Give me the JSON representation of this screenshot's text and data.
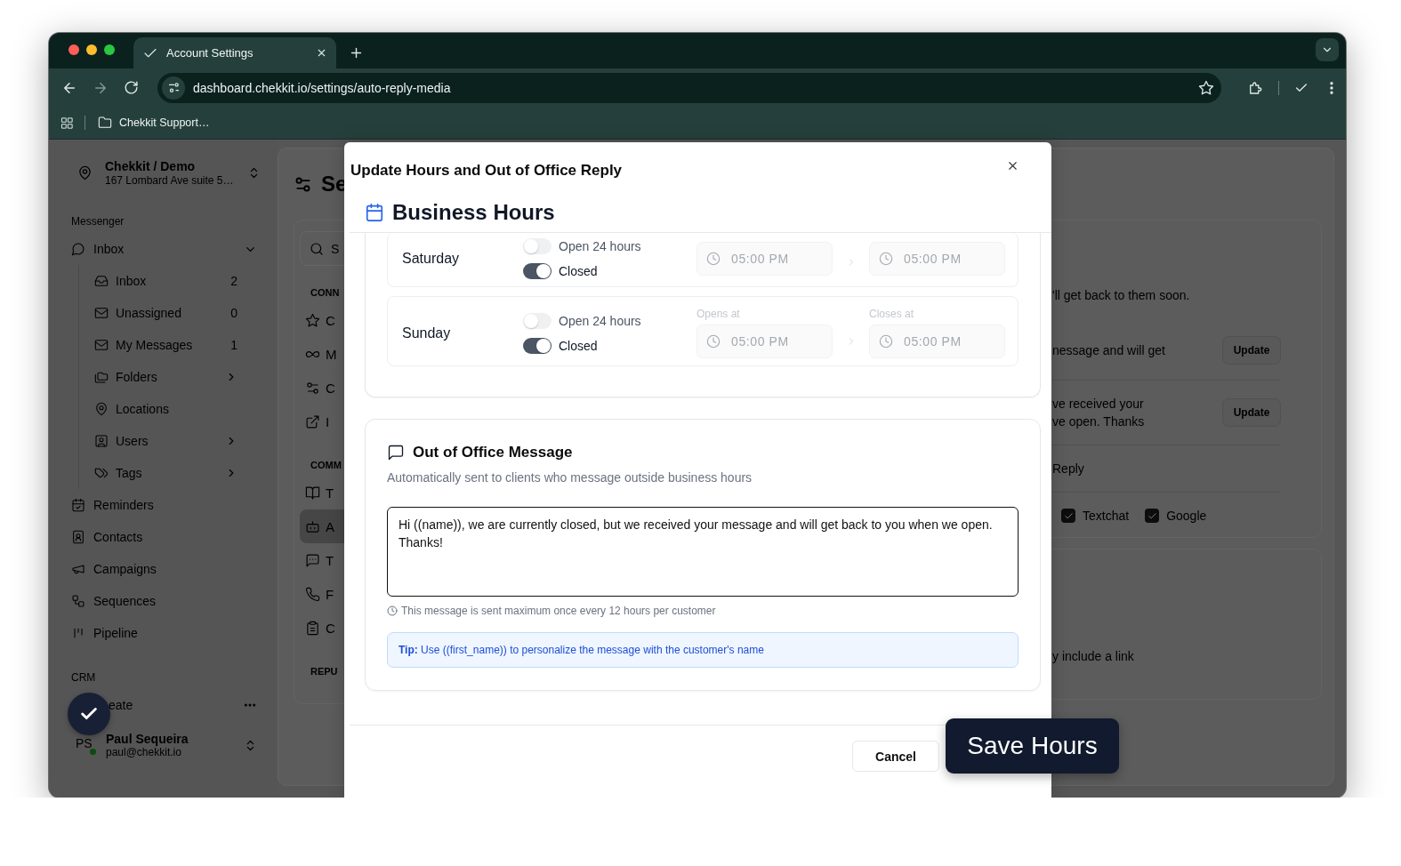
{
  "browser": {
    "tab": {
      "title": "Account Settings"
    },
    "url": "dashboard.chekkit.io/settings/auto-reply-media",
    "bookmarks": [
      {
        "label": "Chekkit Support…"
      }
    ]
  },
  "sidebar": {
    "location": {
      "name": "Chekkit / Demo",
      "address": "167 Lombard Ave suite 5…"
    },
    "messenger_label": "Messenger",
    "inbox": {
      "label": "Inbox",
      "expanded": true,
      "children": [
        {
          "label": "Inbox",
          "count": "2",
          "has_submenu": false
        },
        {
          "label": "Unassigned",
          "count": "0",
          "has_submenu": false
        },
        {
          "label": "My Messages",
          "count": "1",
          "has_submenu": false
        },
        {
          "label": "Folders",
          "has_submenu": true
        },
        {
          "label": "Locations",
          "has_submenu": false
        },
        {
          "label": "Users",
          "has_submenu": true
        },
        {
          "label": "Tags",
          "has_submenu": true
        }
      ]
    },
    "items": [
      {
        "label": "Reminders"
      },
      {
        "label": "Contacts"
      },
      {
        "label": "Campaigns"
      },
      {
        "label": "Sequences"
      },
      {
        "label": "Pipeline"
      }
    ],
    "crm_label": "CRM",
    "crm_items": [
      {
        "label": "eate"
      }
    ],
    "user": {
      "initials": "PS",
      "name": "Paul Sequeira",
      "email": "paul@chekkit.io",
      "online": true
    }
  },
  "settings": {
    "title": "Se",
    "search": {
      "placeholder": "S"
    },
    "groups": [
      {
        "label": "CONN",
        "items": [
          {
            "label": "C",
            "selected": false
          },
          {
            "label": "M",
            "selected": false
          },
          {
            "label": "C",
            "selected": false
          },
          {
            "label": "I",
            "selected": false
          }
        ]
      },
      {
        "label": "COMM",
        "items": [
          {
            "label": "T",
            "selected": false
          },
          {
            "label": "A",
            "selected": true
          },
          {
            "label": "T",
            "selected": false
          },
          {
            "label": "F",
            "selected": false
          },
          {
            "label": "C",
            "selected": false
          }
        ]
      },
      {
        "label": "REPU"
      }
    ]
  },
  "content": {
    "rows": [
      {
        "kind": "text",
        "texts": [
          "'ll get back to them soon."
        ]
      },
      {
        "kind": "action",
        "texts": [
          "nessage and will get"
        ],
        "button": "Update"
      },
      {
        "kind": "action",
        "texts": [
          "ve received your",
          "ve open. Thanks"
        ],
        "button": "Update"
      },
      {
        "kind": "text",
        "texts": [
          "Reply"
        ]
      },
      {
        "kind": "checks",
        "channels": [
          {
            "label": "Textchat",
            "checked": true
          },
          {
            "label": "Google",
            "checked": true
          }
        ]
      }
    ],
    "note": "y include a link"
  },
  "modal": {
    "title": "Update Hours and Out of Office Reply",
    "hours": {
      "title": "Business Hours",
      "days": [
        {
          "day": "Saturday",
          "open_24_label": "Open 24 hours",
          "open_24": false,
          "closed_label": "Closed",
          "closed": true,
          "opens": "05:00 PM",
          "closes": "05:00 PM"
        },
        {
          "day": "Sunday",
          "open_24_label": "Open 24 hours",
          "open_24": false,
          "closed_label": "Closed",
          "closed": true,
          "opens_label": "Opens at",
          "opens": "05:00 PM",
          "closes_label": "Closes at",
          "closes": "05:00 PM"
        }
      ]
    },
    "ooo": {
      "title": "Out of Office Message",
      "subtitle": "Automatically sent to clients who message outside business hours",
      "message": "Hi ((name)), we are currently closed, but we received your message and will get back to you when we open. Thanks!",
      "hint": "This message is sent maximum once every 12 hours per customer",
      "tip": "**Tip:** Use ((first_name)) to personalize the message with the customer's name"
    },
    "buttons": [
      {
        "label": "Cancel",
        "kind": "secondary"
      },
      {
        "label": "Save Hours",
        "kind": "primary"
      }
    ]
  }
}
